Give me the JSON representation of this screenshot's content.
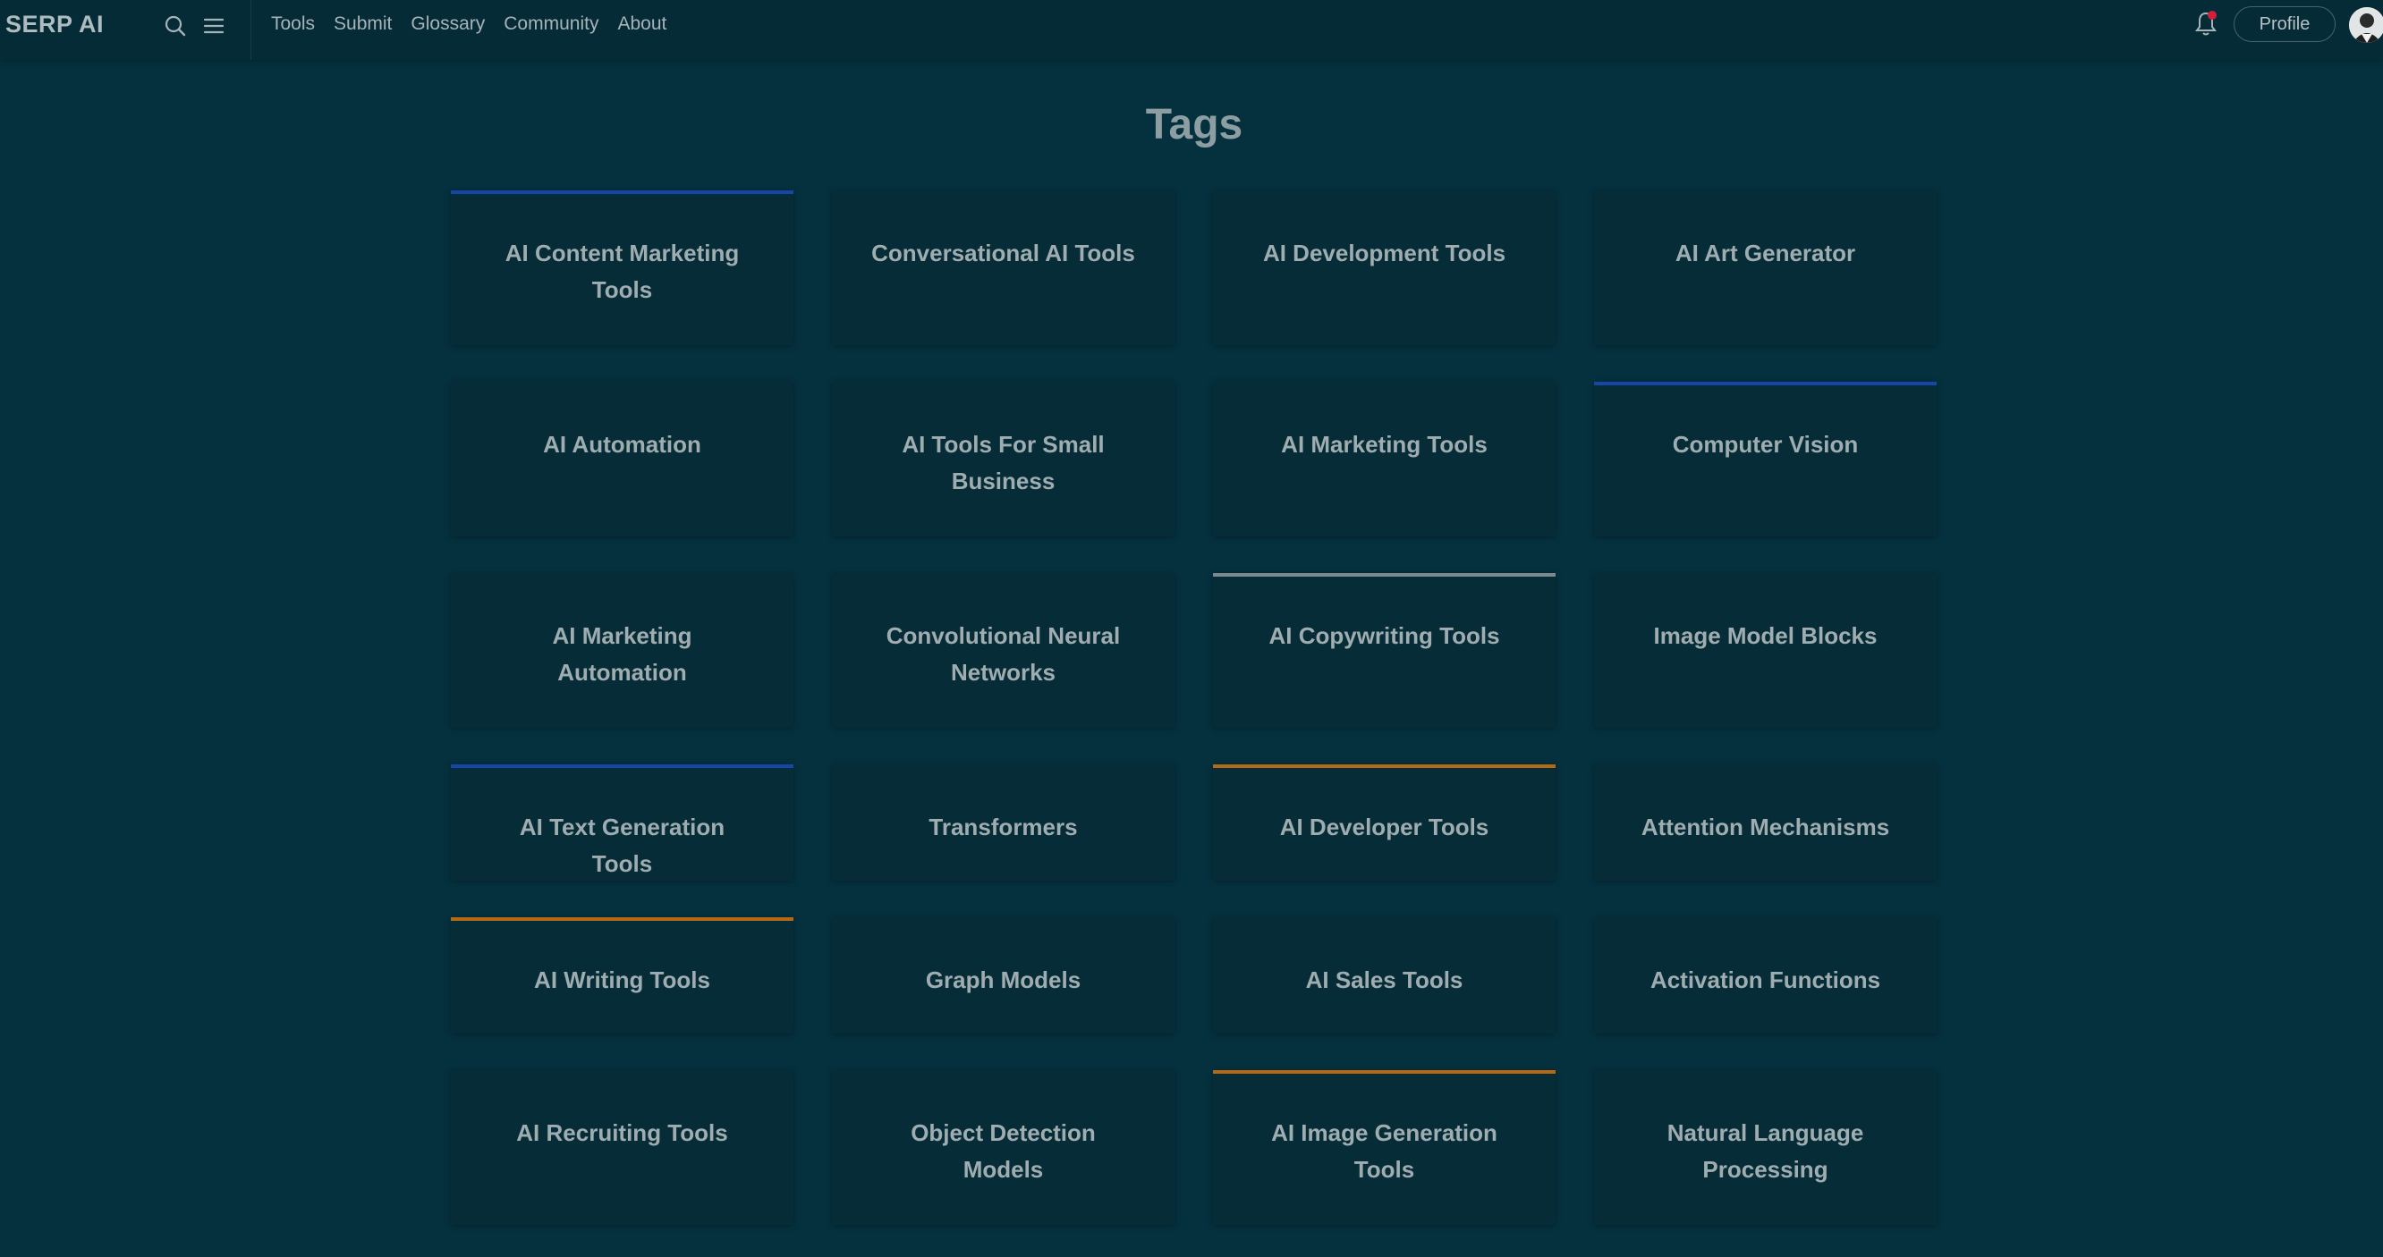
{
  "brand": "SERP AI",
  "nav": [
    "Tools",
    "Submit",
    "Glossary",
    "Community",
    "About"
  ],
  "header": {
    "profile_label": "Profile"
  },
  "page_title": "Tags",
  "accent_colors": {
    "blue": "#1546a8",
    "gray": "#7c8a8f",
    "orange": "#b46a12",
    "notification_dot": "#d21f3c"
  },
  "rows": [
    [
      {
        "label": "AI Content Marketing Tools",
        "accent": "blue"
      },
      {
        "label": "Conversational AI Tools",
        "accent": "none"
      },
      {
        "label": "AI Development Tools",
        "accent": "none"
      },
      {
        "label": "AI Art Generator",
        "accent": "none"
      }
    ],
    [
      {
        "label": "AI Automation",
        "accent": "none"
      },
      {
        "label": "AI Tools For Small Business",
        "accent": "none"
      },
      {
        "label": "AI Marketing Tools",
        "accent": "none"
      },
      {
        "label": "Computer Vision",
        "accent": "blue"
      }
    ],
    [
      {
        "label": "AI Marketing Automation",
        "accent": "none"
      },
      {
        "label": "Convolutional Neural Networks",
        "accent": "none"
      },
      {
        "label": "AI Copywriting Tools",
        "accent": "gray"
      },
      {
        "label": "Image Model Blocks",
        "accent": "none"
      }
    ],
    [
      {
        "label": "AI Text Generation Tools",
        "accent": "blue"
      },
      {
        "label": "Transformers",
        "accent": "none"
      },
      {
        "label": "AI Developer Tools",
        "accent": "orange"
      },
      {
        "label": "Attention Mechanisms",
        "accent": "none"
      }
    ],
    [
      {
        "label": "AI Writing Tools",
        "accent": "orange"
      },
      {
        "label": "Graph Models",
        "accent": "none"
      },
      {
        "label": "AI Sales Tools",
        "accent": "none"
      },
      {
        "label": "Activation Functions",
        "accent": "none"
      }
    ],
    [
      {
        "label": "AI Recruiting Tools",
        "accent": "none"
      },
      {
        "label": "Object Detection Models",
        "accent": "none"
      },
      {
        "label": "AI Image Generation Tools",
        "accent": "orange"
      },
      {
        "label": "Natural Language Processing",
        "accent": "none"
      }
    ]
  ]
}
